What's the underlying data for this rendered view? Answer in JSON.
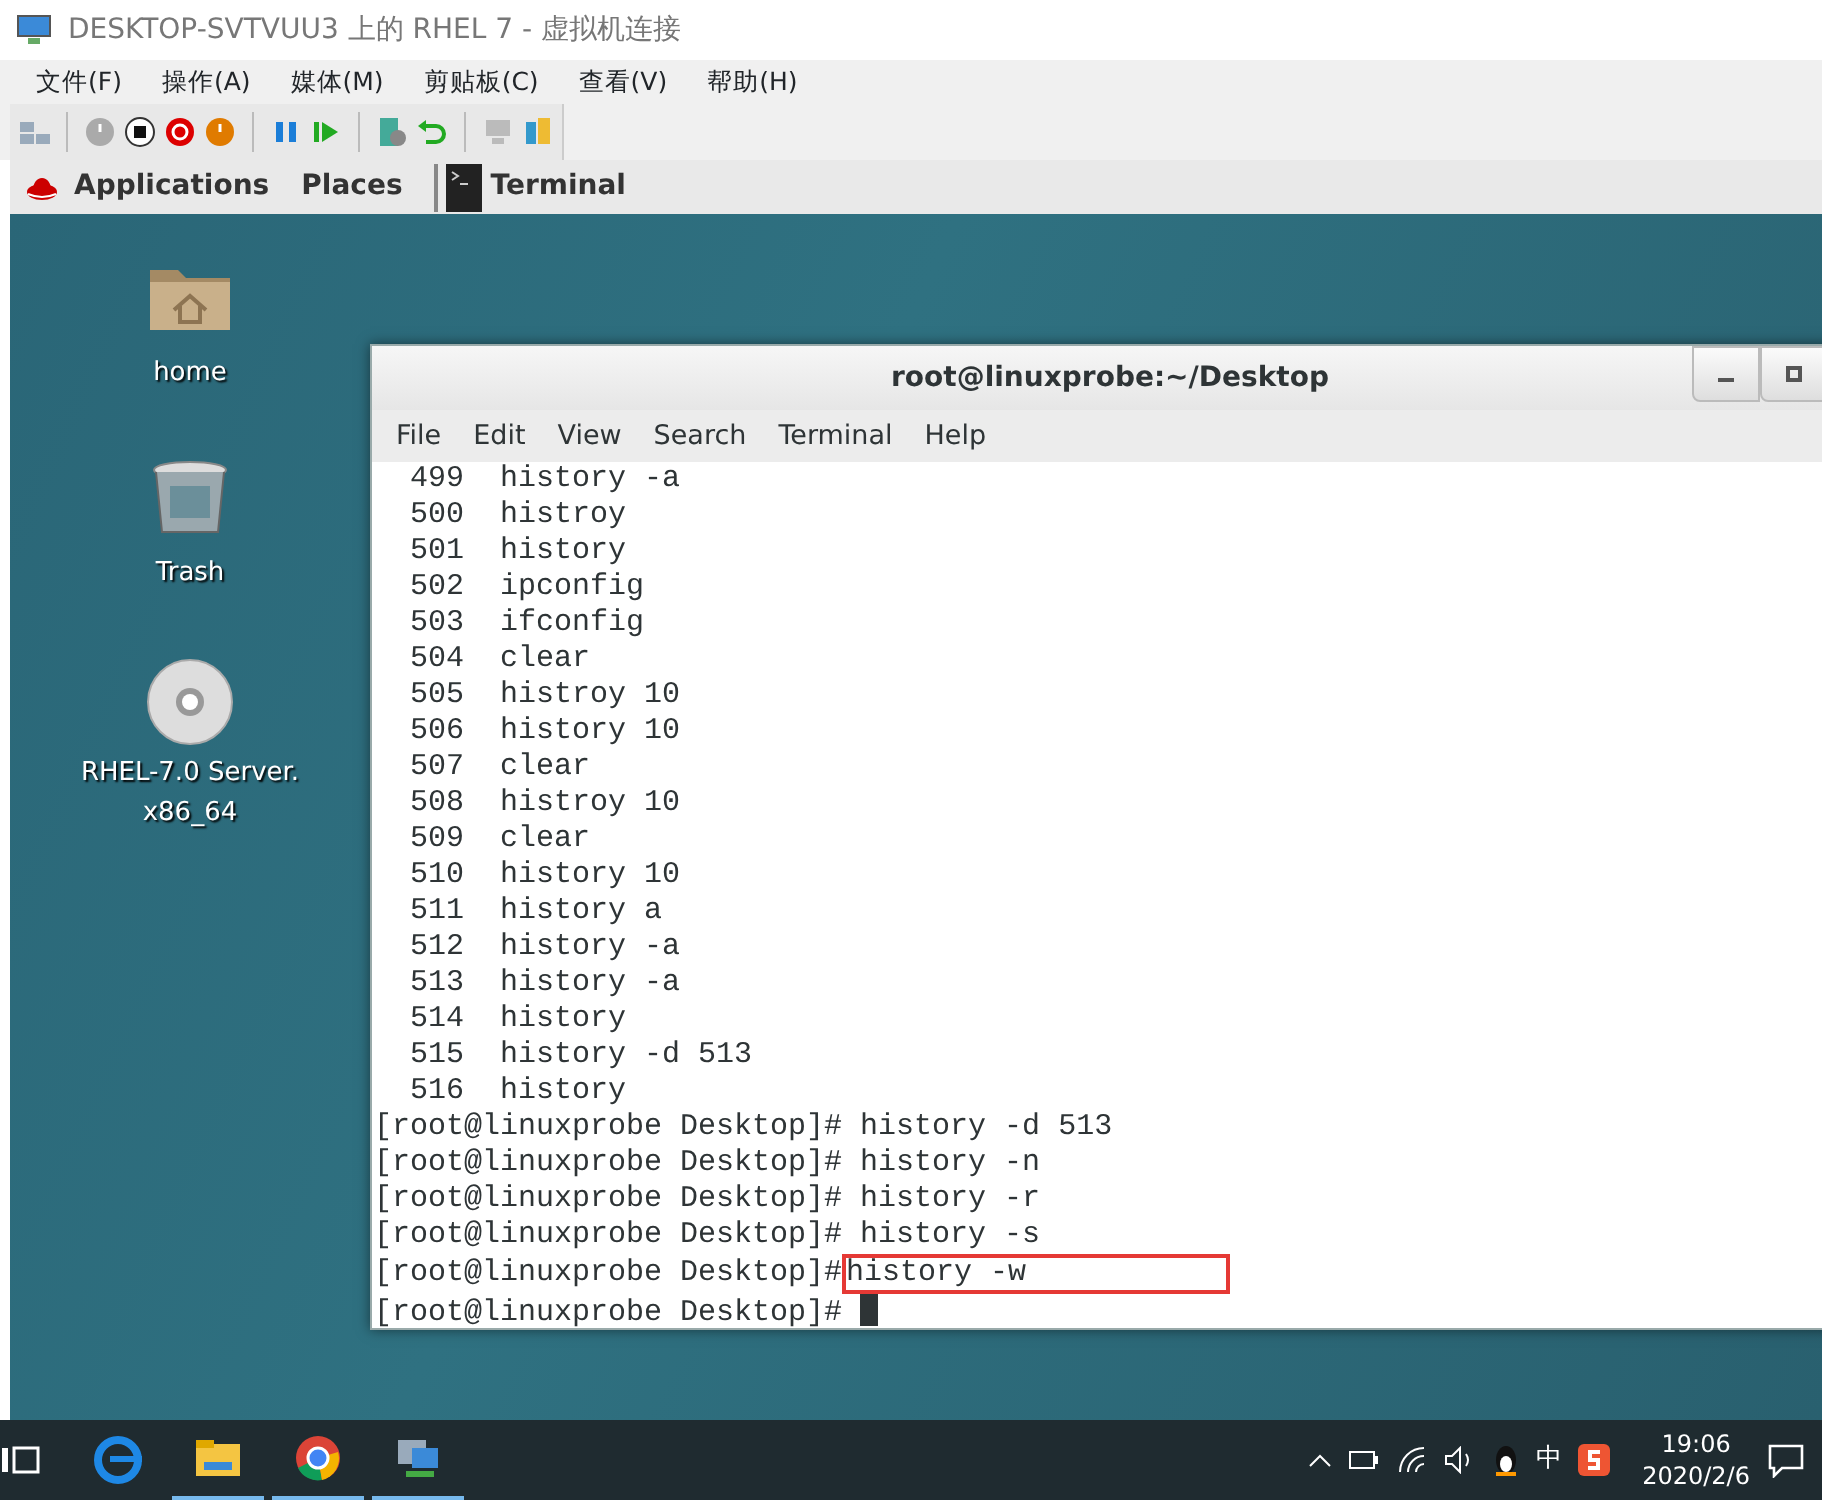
{
  "window": {
    "title": "DESKTOP-SVTVUU3 上的 RHEL 7 - 虚拟机连接"
  },
  "menu": [
    "文件(F)",
    "操作(A)",
    "媒体(M)",
    "剪贴板(C)",
    "查看(V)",
    "帮助(H)"
  ],
  "gnome_bar": {
    "applications": "Applications",
    "places": "Places",
    "task": "Terminal"
  },
  "desktop_icons": [
    {
      "kind": "folder",
      "label": "home"
    },
    {
      "kind": "trash",
      "label": "Trash"
    },
    {
      "kind": "disc",
      "label": "RHEL-7.0 Server.\nx86_64"
    }
  ],
  "terminal": {
    "title": "root@linuxprobe:~/Desktop",
    "menu": [
      "File",
      "Edit",
      "View",
      "Search",
      "Terminal",
      "Help"
    ],
    "lines": [
      {
        "kind": "history",
        "number": "499",
        "command": "history -a"
      },
      {
        "kind": "history",
        "number": "500",
        "command": "histroy"
      },
      {
        "kind": "history",
        "number": "501",
        "command": "history"
      },
      {
        "kind": "history",
        "number": "502",
        "command": "ipconfig"
      },
      {
        "kind": "history",
        "number": "503",
        "command": "ifconfig"
      },
      {
        "kind": "history",
        "number": "504",
        "command": "clear"
      },
      {
        "kind": "history",
        "number": "505",
        "command": "histroy 10"
      },
      {
        "kind": "history",
        "number": "506",
        "command": "history 10"
      },
      {
        "kind": "history",
        "number": "507",
        "command": "clear"
      },
      {
        "kind": "history",
        "number": "508",
        "command": "histroy 10"
      },
      {
        "kind": "history",
        "number": "509",
        "command": "clear"
      },
      {
        "kind": "history",
        "number": "510",
        "command": "history 10"
      },
      {
        "kind": "history",
        "number": "511",
        "command": "history a"
      },
      {
        "kind": "history",
        "number": "512",
        "command": "history -a"
      },
      {
        "kind": "history",
        "number": "513",
        "command": "history -a"
      },
      {
        "kind": "history",
        "number": "514",
        "command": "history"
      },
      {
        "kind": "history",
        "number": "515",
        "command": "history -d 513"
      },
      {
        "kind": "history",
        "number": "516",
        "command": "history"
      },
      {
        "kind": "prompt",
        "prompt": "[root@linuxprobe Desktop]#",
        "command": "history -d 513"
      },
      {
        "kind": "prompt",
        "prompt": "[root@linuxprobe Desktop]#",
        "command": "history -n"
      },
      {
        "kind": "prompt",
        "prompt": "[root@linuxprobe Desktop]#",
        "command": "history -r"
      },
      {
        "kind": "prompt",
        "prompt": "[root@linuxprobe Desktop]#",
        "command": "history -s"
      },
      {
        "kind": "prompt",
        "prompt": "[root@linuxprobe Desktop]#",
        "command": "history -w",
        "highlighted": true
      },
      {
        "kind": "prompt",
        "prompt": "[root@linuxprobe Desktop]#",
        "cursor": true
      }
    ]
  },
  "taskbar": {
    "ime": "中",
    "time": "19:06",
    "date": "2020/2/6"
  }
}
